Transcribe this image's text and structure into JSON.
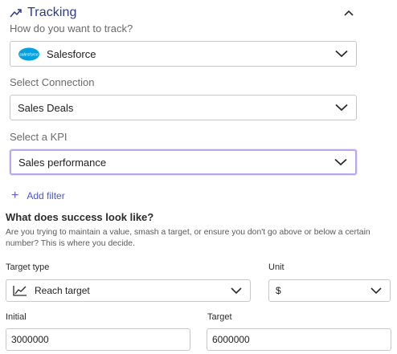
{
  "section": {
    "title": "Tracking",
    "icon": "trending-up-icon",
    "collapse_icon": "chevron-up-icon"
  },
  "tracking_method": {
    "label": "How do you want to track?",
    "value": "Salesforce",
    "logo_text": "salesforce"
  },
  "connection": {
    "label": "Select Connection",
    "value": "Sales Deals"
  },
  "kpi": {
    "label": "Select a KPI",
    "value": "Sales performance"
  },
  "add_filter": {
    "label": "Add filter"
  },
  "success": {
    "heading": "What does success look like?",
    "description": "Are you trying to maintain a value, smash a target, or ensure you don't go above or below a certain number? This is where you decide."
  },
  "target_type": {
    "label": "Target type",
    "value": "Reach target"
  },
  "unit": {
    "label": "Unit",
    "value": "$"
  },
  "initial": {
    "label": "Initial",
    "value": "3000000"
  },
  "target": {
    "label": "Target",
    "value": "6000000"
  },
  "colors": {
    "accent": "#2d3a8c",
    "link": "#4c55c7",
    "focus_border": "#b9a7ee",
    "salesforce_blue": "#00a1e0"
  }
}
